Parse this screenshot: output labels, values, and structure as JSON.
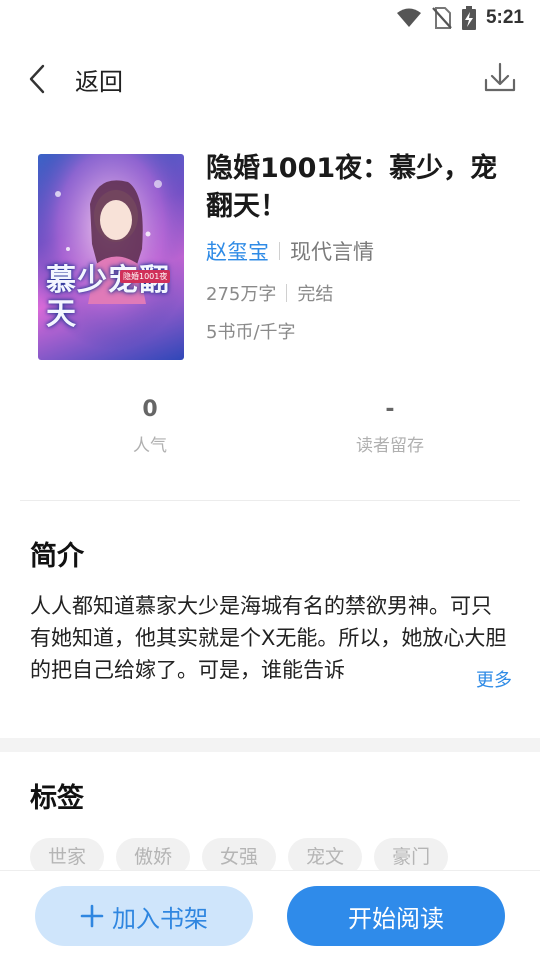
{
  "status_bar": {
    "time": "5:21"
  },
  "header": {
    "back_label": "返回"
  },
  "book": {
    "title": "隐婚1001夜：慕少，宠翻天！",
    "author": "赵玺宝",
    "genre": "现代言情",
    "word_count": "275万字",
    "status": "完结",
    "price": "5书币/千字",
    "cover_text": {
      "main": "慕少宠翻天",
      "badge": "隐婚1001夜"
    }
  },
  "stats": [
    {
      "value": "0",
      "label": "人气"
    },
    {
      "value": "-",
      "label": "读者留存"
    }
  ],
  "intro": {
    "title": "简介",
    "text": "人人都知道慕家大少是海城有名的禁欲男神。可只有她知道，他其实就是个X无能。所以，她放心大胆的把自己给嫁了。可是，谁能告诉",
    "more_label": "更多"
  },
  "tags": {
    "title": "标签",
    "items": [
      "世家",
      "傲娇",
      "女强",
      "宠文",
      "豪门"
    ]
  },
  "actions": {
    "add_shelf_label": "加入书架",
    "start_read_label": "开始阅读"
  },
  "colors": {
    "accent": "#2f8bea",
    "accent_light": "#cfe5fb",
    "author": "#2f8be6"
  }
}
